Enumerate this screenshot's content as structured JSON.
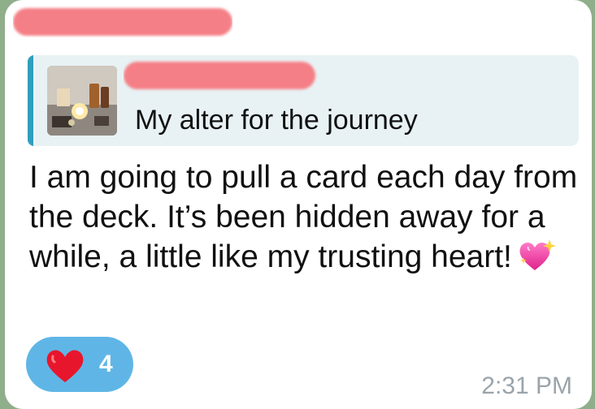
{
  "message": {
    "sender_name": "",
    "reply": {
      "author": "",
      "text": "My alter for the journey",
      "thumbnail": "altar-photo"
    },
    "text": "I am going to pull a card each day from the deck.   It’s been hidden away for a while, a little like my trusting heart!",
    "emoji": "sparkling-heart-icon",
    "reaction": {
      "emoji": "red-heart-icon",
      "count": "4"
    },
    "time": "2:31 PM"
  },
  "colors": {
    "background": "#8fae8a",
    "bubble": "#ffffff",
    "reply_accent": "#2f9fbd",
    "reply_bg": "#e8f2f4",
    "reaction_bg": "#5fb6e6",
    "redaction": "#f57f86",
    "timestamp": "#9aa4aa"
  }
}
